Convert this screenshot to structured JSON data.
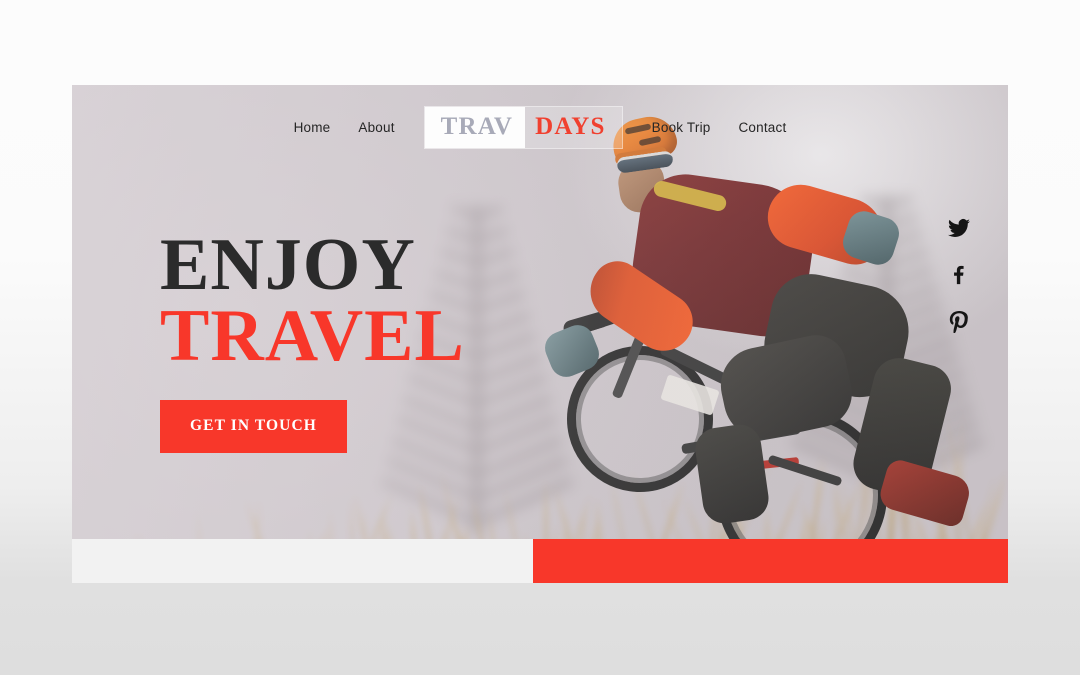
{
  "site": {
    "title": "Trav Days",
    "brand": {
      "part_one": "TRAV",
      "part_two": "DAYS",
      "part_one_color": "#a8aab8",
      "part_two_color": "#f0402f"
    }
  },
  "nav": {
    "left_items": [
      {
        "label": "Home"
      },
      {
        "label": "About"
      }
    ],
    "right_items": [
      {
        "label": "Book Trip"
      },
      {
        "label": "Contact"
      }
    ],
    "link_color": "#262626"
  },
  "hero": {
    "heading_line_1": "ENJOY",
    "heading_line_2": "TRAVEL",
    "heading_line_1_color": "#2b2b2b",
    "heading_line_2_color": "#f8372a",
    "cta_label": "GET IN TOUCH",
    "cta_bg": "#f8372a",
    "cta_text_color": "#ffffff",
    "image_alt": "Mountain biker riding downhill through dry grass"
  },
  "social": [
    {
      "name": "twitter",
      "icon": "twitter-icon",
      "label": "Twitter"
    },
    {
      "name": "facebook",
      "icon": "facebook-icon",
      "label": "Facebook"
    },
    {
      "name": "pinterest",
      "icon": "pinterest-icon",
      "label": "Pinterest"
    }
  ],
  "footer_strips": {
    "light_color": "#f2f2f2",
    "accent_color": "#f8372a"
  },
  "page": {
    "background_top": "#fcfcfc",
    "background_bottom": "#dedede"
  }
}
